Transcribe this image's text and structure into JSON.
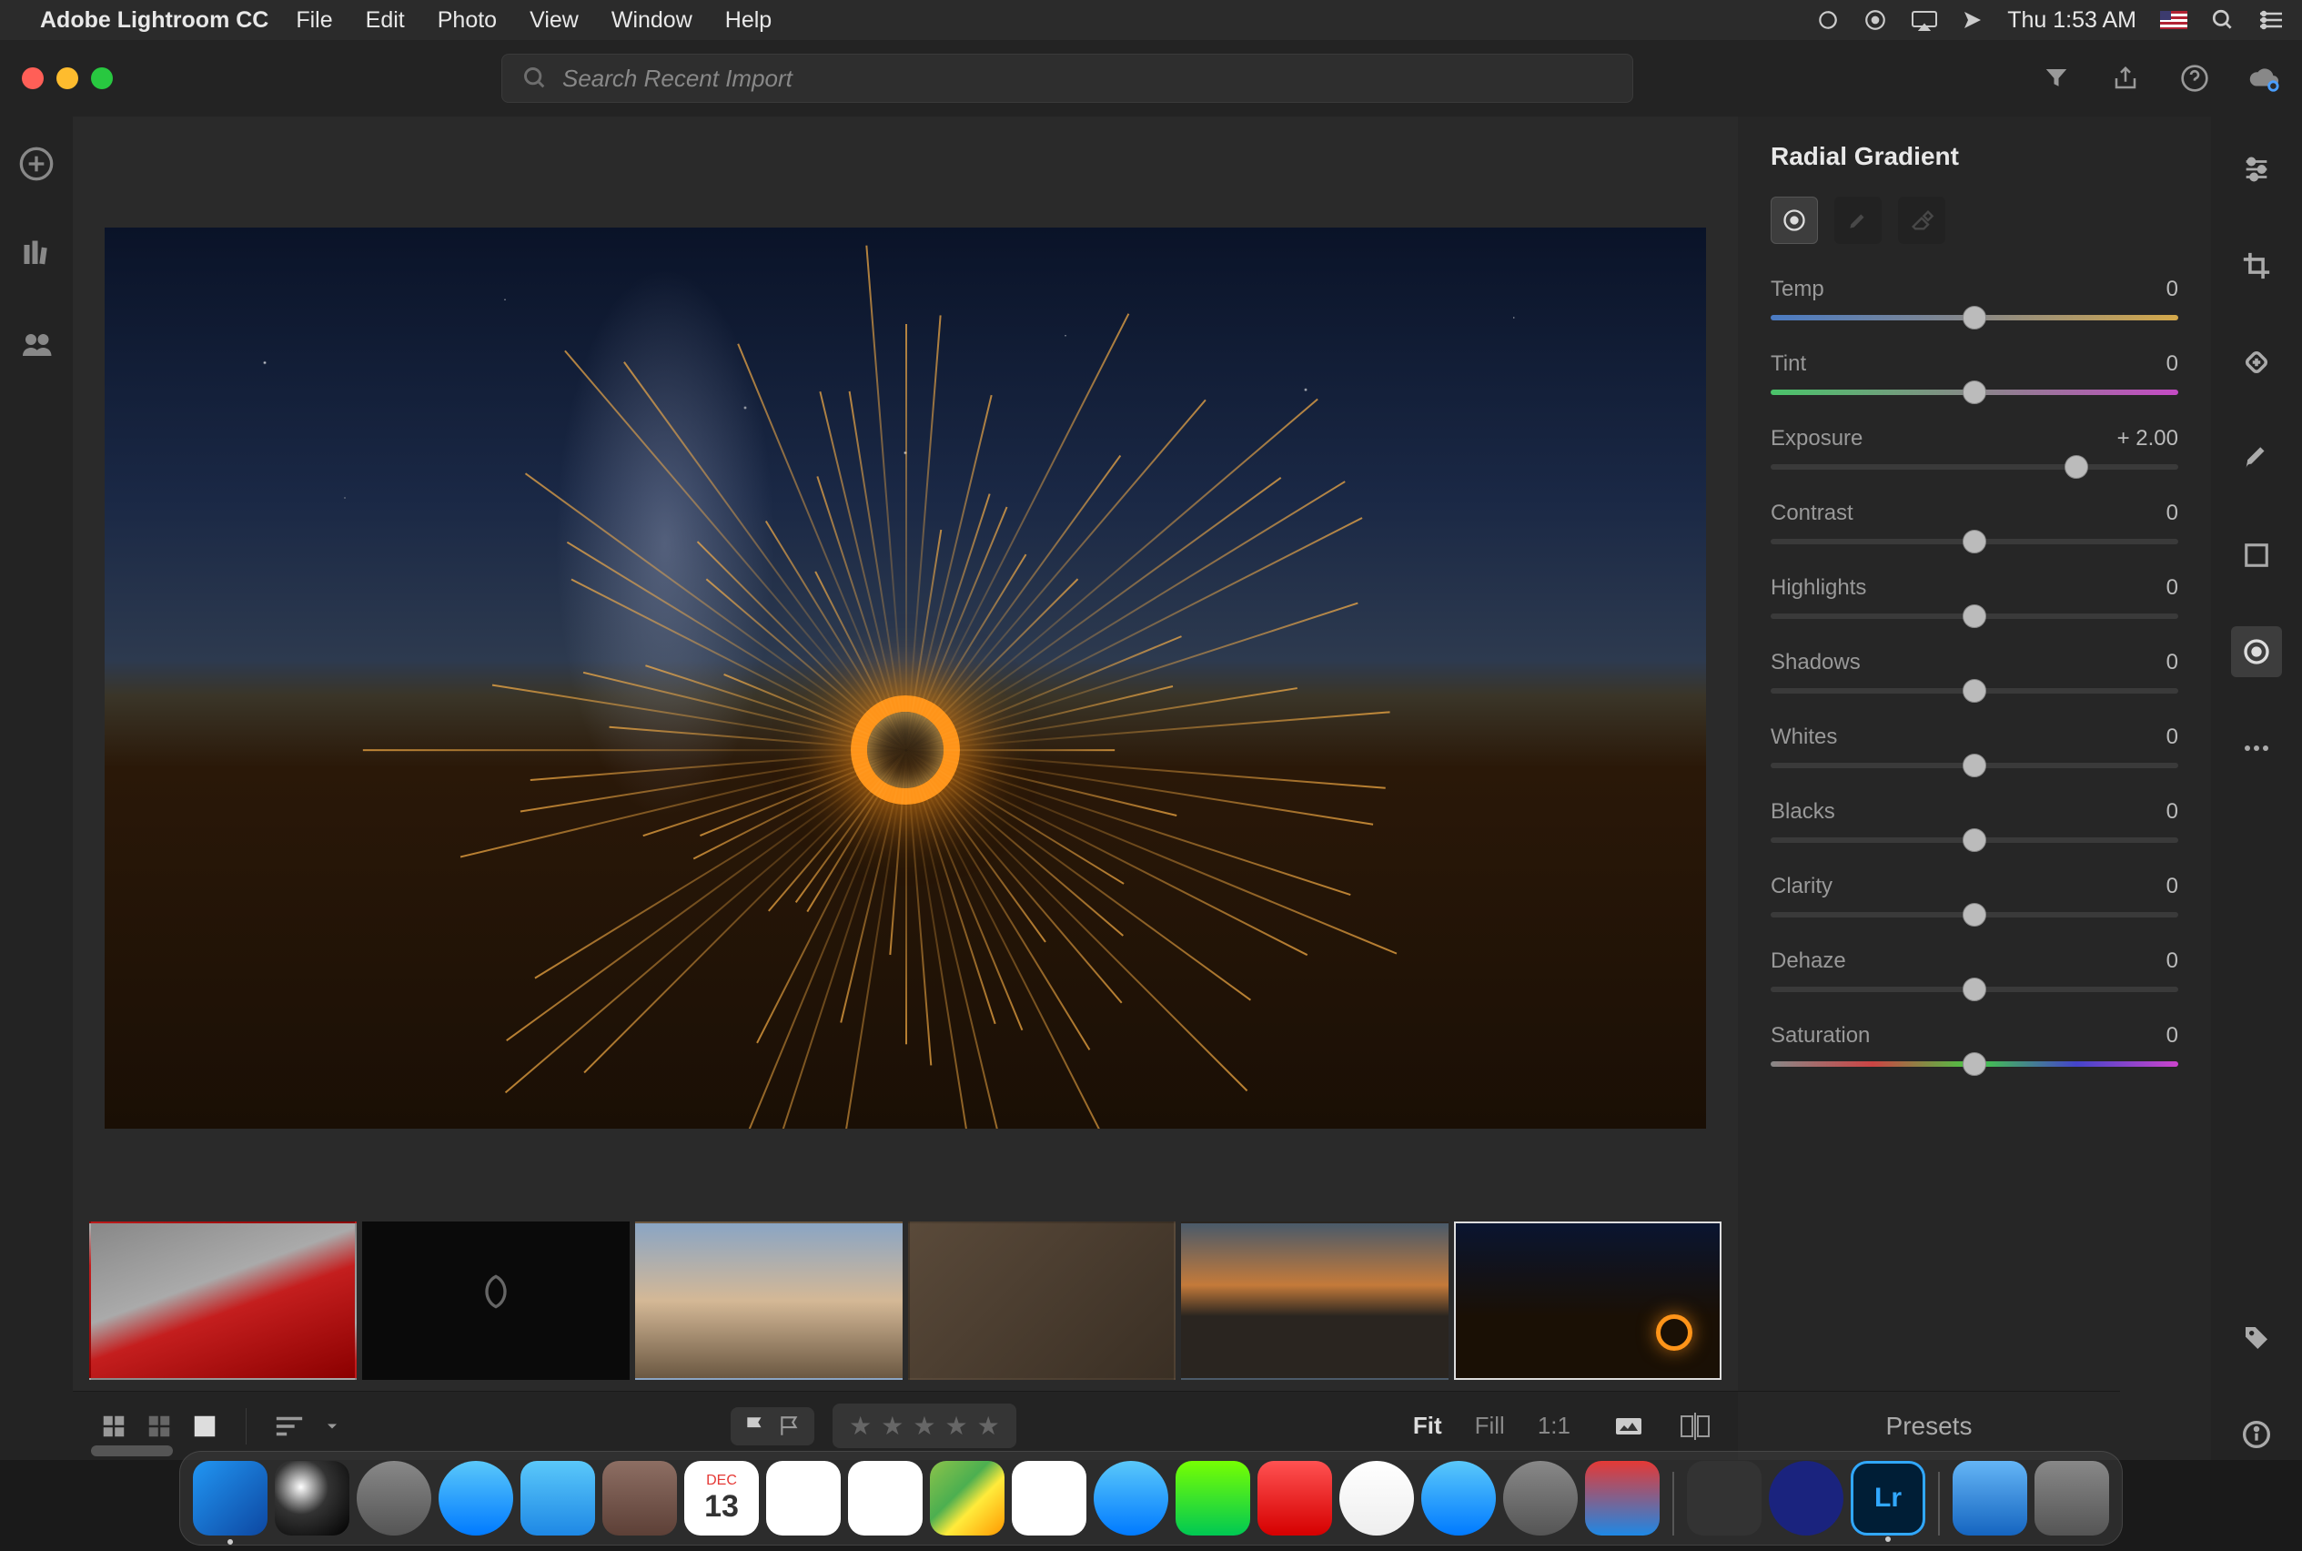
{
  "menubar": {
    "app_name": "Adobe Lightroom CC",
    "items": [
      "File",
      "Edit",
      "Photo",
      "View",
      "Window",
      "Help"
    ],
    "clock": "Thu 1:53 AM"
  },
  "chrome": {
    "search_placeholder": "Search Recent Import"
  },
  "panel": {
    "title": "Radial Gradient",
    "sliders": [
      {
        "label": "Temp",
        "value": "0",
        "pos": 50,
        "track": "temp"
      },
      {
        "label": "Tint",
        "value": "0",
        "pos": 50,
        "track": "tint"
      },
      {
        "label": "Exposure",
        "value": "+ 2.00",
        "pos": 75,
        "track": ""
      },
      {
        "label": "Contrast",
        "value": "0",
        "pos": 50,
        "track": ""
      },
      {
        "label": "Highlights",
        "value": "0",
        "pos": 50,
        "track": ""
      },
      {
        "label": "Shadows",
        "value": "0",
        "pos": 50,
        "track": ""
      },
      {
        "label": "Whites",
        "value": "0",
        "pos": 50,
        "track": ""
      },
      {
        "label": "Blacks",
        "value": "0",
        "pos": 50,
        "track": ""
      },
      {
        "label": "Clarity",
        "value": "0",
        "pos": 50,
        "track": ""
      },
      {
        "label": "Dehaze",
        "value": "0",
        "pos": 50,
        "track": ""
      },
      {
        "label": "Saturation",
        "value": "0",
        "pos": 50,
        "track": "sat"
      }
    ],
    "presets_label": "Presets"
  },
  "bottom": {
    "zoom": {
      "fit": "Fit",
      "fill": "Fill",
      "one": "1:1"
    }
  },
  "dock": {
    "cal_month": "DEC",
    "cal_day": "13",
    "lr": "Lr"
  }
}
